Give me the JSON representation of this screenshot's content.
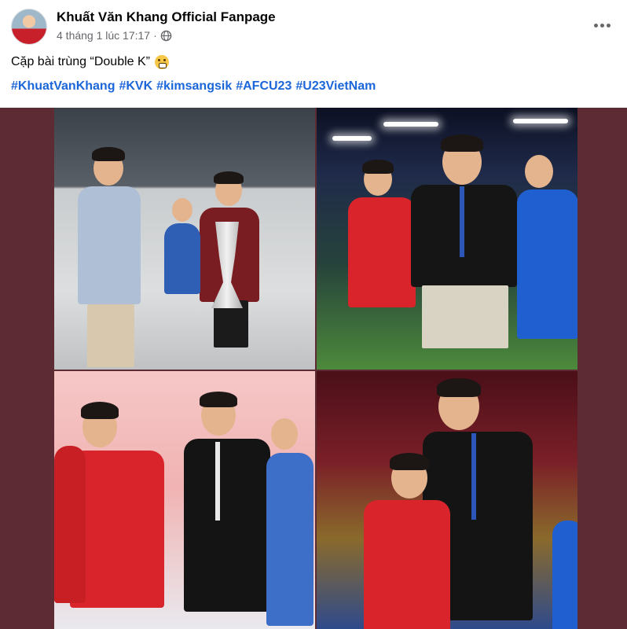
{
  "post": {
    "author_name": "Khuất Văn Khang Official Fanpage",
    "timestamp": "4 tháng 1 lúc 17:17",
    "separator": "·",
    "audience_icon": "globe-icon",
    "more_icon": "more-options-icon",
    "caption": "Cặp bài trùng “Double K”",
    "caption_emoji": "grimacing-face-emoji",
    "hashtags": [
      "#KhuatVanKhang",
      "#KVK",
      "#kimsangsik",
      "#AFCU23",
      "#U23VietNam"
    ]
  },
  "media": {
    "photo_count": 4,
    "photos": [
      {
        "scene": "airport-walk-with-trophy"
      },
      {
        "scene": "stadium-celebration-night"
      },
      {
        "scene": "players-clapping"
      },
      {
        "scene": "coach-hugging-player"
      }
    ]
  },
  "colors": {
    "hashtag": "#1b66d9",
    "meta_text": "#65676b",
    "media_background": "#5c2b33"
  }
}
